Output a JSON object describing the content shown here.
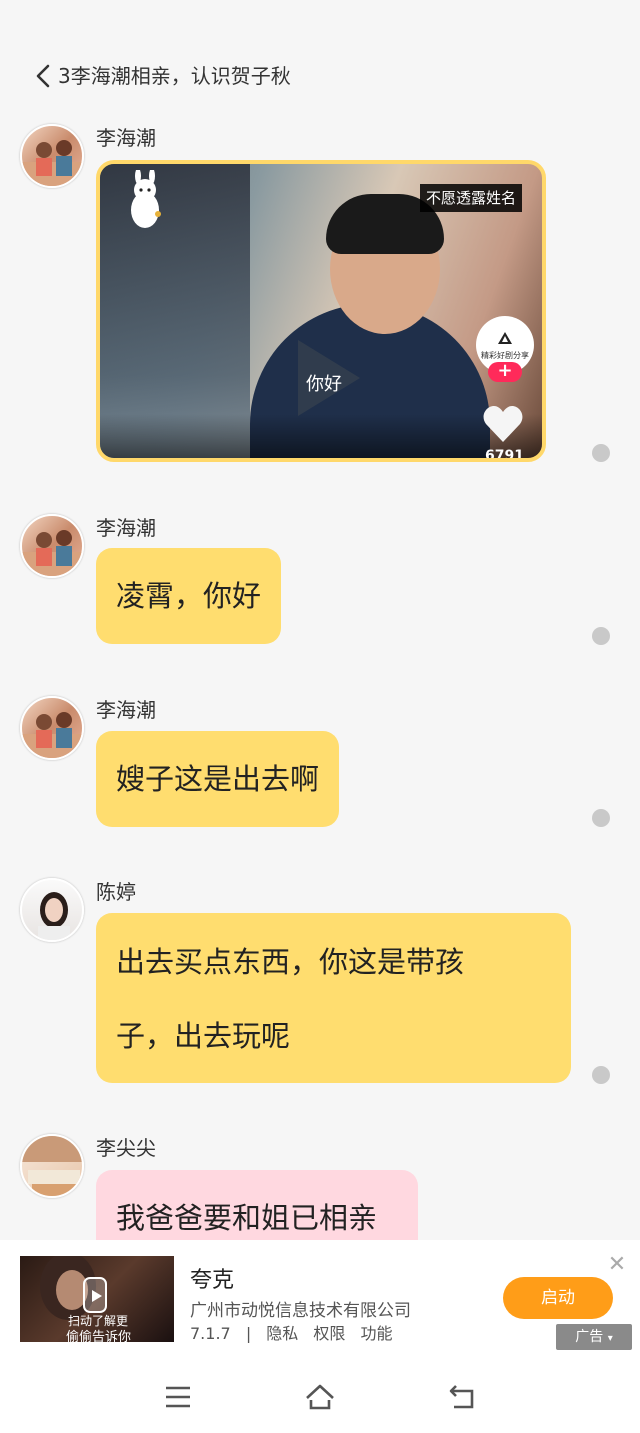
{
  "header": {
    "title": "3李海潮相亲，认识贺子秋"
  },
  "messages": [
    {
      "sender": "李海潮",
      "type": "video",
      "video": {
        "badge": "不愿透露姓名",
        "caption": "你好",
        "share_label": "精彩好剧分享",
        "plus": "+",
        "likes": "6791"
      }
    },
    {
      "sender": "李海潮",
      "text": "凌霄，你好"
    },
    {
      "sender": "李海潮",
      "text": "嫂子这是出去啊"
    },
    {
      "sender": "陈婷",
      "line1": "出去买点东西，你这是带孩",
      "line2": "子，出去玩呢"
    },
    {
      "sender": "李尖尖",
      "text": "我爸爸要和姐已相亲"
    }
  ],
  "ad": {
    "thumb_line1": "扫动了解更",
    "thumb_line2": "偷偷告诉你",
    "name": "夸克",
    "company": "广州市动悦信息技术有限公司",
    "version": "7.1.7",
    "separator": "|",
    "privacy": "隐私",
    "permissions": "权限",
    "features": "功能",
    "button": "启动",
    "close": "✕",
    "tag": "广告"
  },
  "colors": {
    "bubble": "#ffdd6f",
    "bubble_pink": "#ffd8e0",
    "video_border": "#ffd86a",
    "ad_button": "#ff9d18"
  }
}
